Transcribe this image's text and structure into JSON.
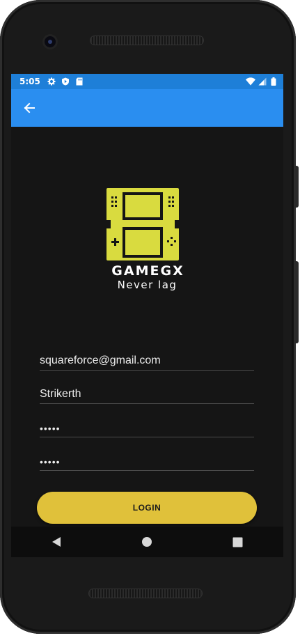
{
  "status_bar": {
    "time": "5:05",
    "icons": [
      "gear-icon",
      "shield-play-icon",
      "sd-card-icon",
      "wifi-icon",
      "signal-icon",
      "battery-icon"
    ]
  },
  "app_bar": {
    "back_icon": "arrow-left-icon"
  },
  "logo": {
    "brand": "GAMEGX",
    "tagline": "Never lag",
    "color": "#d9db3f"
  },
  "form": {
    "email": "squareforce@gmail.com",
    "username": "Strikerth",
    "password": "•••••",
    "confirm_password": "•••••",
    "login_label": "LOGIN"
  },
  "colors": {
    "status_bar": "#1e7fd8",
    "app_bar": "#2a8ef0",
    "background": "#151515",
    "button": "#e0c13a"
  },
  "nav_bar": {
    "icons": [
      "back-triangle-icon",
      "home-circle-icon",
      "recents-square-icon"
    ]
  }
}
